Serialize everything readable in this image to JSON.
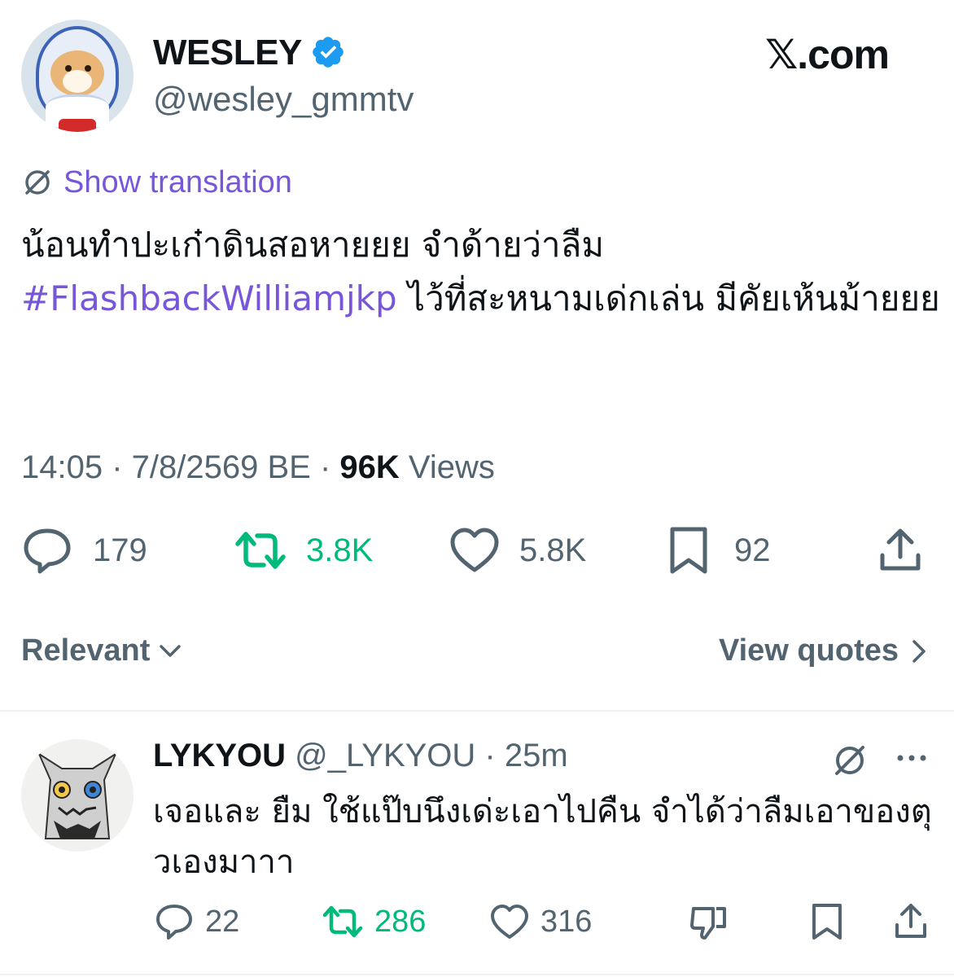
{
  "author": {
    "name": "WESLEY",
    "handle": "@wesley_gmmtv"
  },
  "brand": {
    "logo_text": "𝕏.com"
  },
  "translation": {
    "label": "Show translation"
  },
  "tweet": {
    "text_before": "น้อนทำปะเก๋าดินสอหายยย จำด้ายว่าลืม ",
    "hashtag": "#FlashbackWilliamjkp",
    "text_after": " ไว้ที่สะหนามเด่กเล่น มีคัยเห้นม้ายยย"
  },
  "meta": {
    "time": "14:05",
    "separator": " · ",
    "date": "7/8/2569 BE",
    "views_count": "96K",
    "views_label": " Views"
  },
  "actions": {
    "replies": "179",
    "reposts": "3.8K",
    "likes": "5.8K",
    "bookmarks": "92"
  },
  "sort": {
    "label": "Relevant"
  },
  "quotes": {
    "label": "View quotes"
  },
  "reply": {
    "name": "LYKYOU",
    "handle": "@_LYKYOU",
    "separator": " · ",
    "time": "25m",
    "text": "เจอและ ยืม ใช้แป๊บนึงเด่ะเอาไปคืน จำได้ว่าลืมเอาของตุวเองมาาา",
    "actions": {
      "replies": "22",
      "reposts": "286",
      "likes": "316"
    }
  },
  "colors": {
    "accent": "#7856d9",
    "repost": "#00ba7c",
    "verified": "#1d9bf0",
    "secondary_text": "#536471"
  }
}
